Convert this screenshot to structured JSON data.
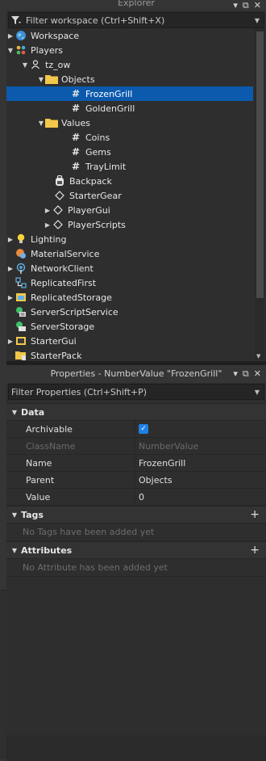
{
  "explorer": {
    "title": "Explorer",
    "filter_placeholder": "Filter workspace (Ctrl+Shift+X)",
    "items": [
      {
        "label": "Workspace"
      },
      {
        "label": "Players"
      },
      {
        "label": "tz_ow"
      },
      {
        "label": "Objects"
      },
      {
        "label": "FrozenGrill"
      },
      {
        "label": "GoldenGrill"
      },
      {
        "label": "Values"
      },
      {
        "label": "Coins"
      },
      {
        "label": "Gems"
      },
      {
        "label": "TrayLimit"
      },
      {
        "label": "Backpack"
      },
      {
        "label": "StarterGear"
      },
      {
        "label": "PlayerGui"
      },
      {
        "label": "PlayerScripts"
      },
      {
        "label": "Lighting"
      },
      {
        "label": "MaterialService"
      },
      {
        "label": "NetworkClient"
      },
      {
        "label": "ReplicatedFirst"
      },
      {
        "label": "ReplicatedStorage"
      },
      {
        "label": "ServerScriptService"
      },
      {
        "label": "ServerStorage"
      },
      {
        "label": "StarterGui"
      },
      {
        "label": "StarterPack"
      }
    ]
  },
  "properties": {
    "title": "Properties - NumberValue \"FrozenGrill\"",
    "filter_placeholder": "Filter Properties (Ctrl+Shift+P)",
    "sections": {
      "data": "Data",
      "tags": "Tags",
      "attributes": "Attributes"
    },
    "rows": [
      {
        "name": "Archivable",
        "value": ""
      },
      {
        "name": "ClassName",
        "value": "NumberValue"
      },
      {
        "name": "Name",
        "value": "FrozenGrill"
      },
      {
        "name": "Parent",
        "value": "Objects"
      },
      {
        "name": "Value",
        "value": "0"
      }
    ],
    "tags_empty": "No Tags have been added yet",
    "attributes_empty": "No Attribute has been added yet"
  },
  "colors": {
    "selection": "#0b5aad",
    "accent": "#1e80e3"
  }
}
